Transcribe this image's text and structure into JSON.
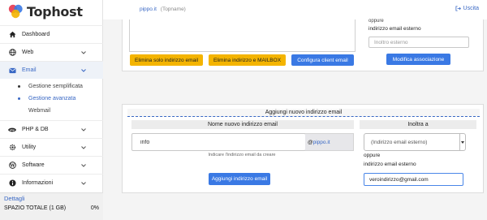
{
  "brand": {
    "name": "Tophost"
  },
  "header": {
    "domain": "pippo.it",
    "type_label": "(Topname)",
    "logout_label": "Uscita"
  },
  "sidebar": {
    "items": [
      {
        "label": "Dashboard",
        "icon": "home-icon"
      },
      {
        "label": "Web",
        "icon": "globe-icon"
      },
      {
        "label": "Email",
        "icon": "envelope-icon"
      },
      {
        "label": "PHP & DB",
        "icon": "database-icon"
      },
      {
        "label": "Utility",
        "icon": "gear-icon"
      },
      {
        "label": "Software",
        "icon": "wordpress-icon"
      },
      {
        "label": "Informazioni",
        "icon": "info-icon"
      }
    ],
    "email_sub": [
      "Gestione semplificata",
      "Gestione avanzata",
      "Webmail"
    ],
    "details": {
      "title": "Dettagli",
      "space_label": "SPAZIO TOTALE (1 GB)",
      "space_value": "0%"
    }
  },
  "panel1": {
    "buttons": {
      "delete_email_only": "Elimina solo indirizzo email",
      "delete_email_mailbox": "Elimina indirizzo e MAILBOX",
      "configure_client": "Configura client email",
      "modify_association": "Modifica associazione"
    },
    "oppure_partial": "oppure",
    "external_email_label": "indirizzo email esterno",
    "external_placeholder": "Inoltro esterno"
  },
  "panel2": {
    "title": "Aggiungi nuovo indirizzo email",
    "col_left": "Nome nuovo indirizzo email",
    "col_right": "Inoltra a",
    "name_value": "info",
    "at_prefix": "@",
    "domain": "pippo.it",
    "hint": "Indicare l'indirizzo email da creare",
    "add_button": "Aggiungi indirizzo email",
    "select_value": "(Indirizzo email esterno)",
    "oppure": "oppure",
    "external_label": "indirizzo email esterno",
    "external_value": "veroindirizzo@gmail.com"
  },
  "colors": {
    "accent_blue": "#3867c4",
    "button_blue": "#3a79e4",
    "button_yellow": "#f4b400"
  }
}
